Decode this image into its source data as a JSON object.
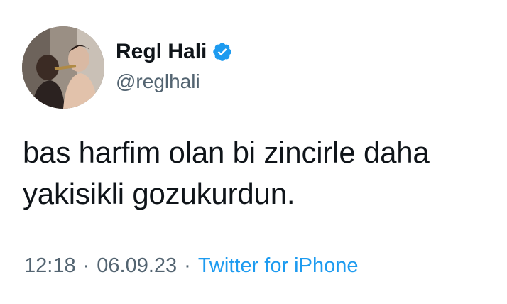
{
  "author": {
    "display_name": "Regl Hali",
    "handle": "@reglhali",
    "verified": true,
    "avatar": "profile-photo"
  },
  "tweet": {
    "line1": "bas harfim olan bi zincirle daha",
    "line2": "yakisikli gozukurdun."
  },
  "meta": {
    "time": "12:18",
    "separator": "·",
    "date": "06.09.23",
    "source": "Twitter for iPhone"
  },
  "colors": {
    "text": "#0f1419",
    "secondary": "#536471",
    "link": "#1d9bf0",
    "verified_badge": "#1d9bf0"
  }
}
